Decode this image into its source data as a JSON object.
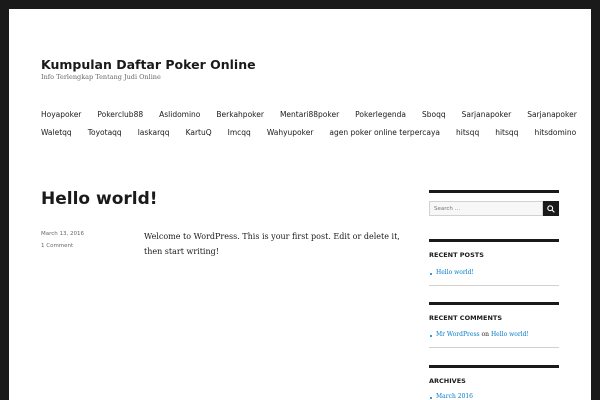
{
  "site": {
    "title": "Kumpulan Daftar Poker Online",
    "description": "Info Terlengkap Tentang Judi Online"
  },
  "nav": {
    "row1": [
      "Hoyapoker",
      "Pokerclub88",
      "Aslidomino",
      "Berkahpoker",
      "Mentari88poker",
      "Pokerlegenda",
      "Sboqq",
      "Sarjanapoker",
      "Sarjanapoker"
    ],
    "row2": [
      "Waletqq",
      "Toyotaqq",
      "laskarqq",
      "KartuQ",
      "Imcqq",
      "Wahyupoker",
      "agen poker online terpercaya",
      "hitsqq",
      "hitsqq",
      "hitsdomino"
    ]
  },
  "post": {
    "title": "Hello world!",
    "date": "March 13, 2016",
    "comments": "1 Comment",
    "body": "Welcome to WordPress. This is your first post. Edit or delete it, then start writing!"
  },
  "sidebar": {
    "search_placeholder": "Search …",
    "search_icon": "magnifier-icon",
    "recent_posts_title": "RECENT POSTS",
    "recent_posts": [
      "Hello world!"
    ],
    "recent_comments_title": "RECENT COMMENTS",
    "recent_comment_author": "Mr WordPress",
    "recent_comment_on": "on",
    "recent_comment_post": "Hello world!",
    "archives_title": "ARCHIVES",
    "archives": [
      "March 2016"
    ]
  },
  "colors": {
    "background": "#1a1a1a",
    "page": "#ffffff",
    "link": "#007acc",
    "text": "#1a1a1a",
    "muted": "#686868"
  }
}
